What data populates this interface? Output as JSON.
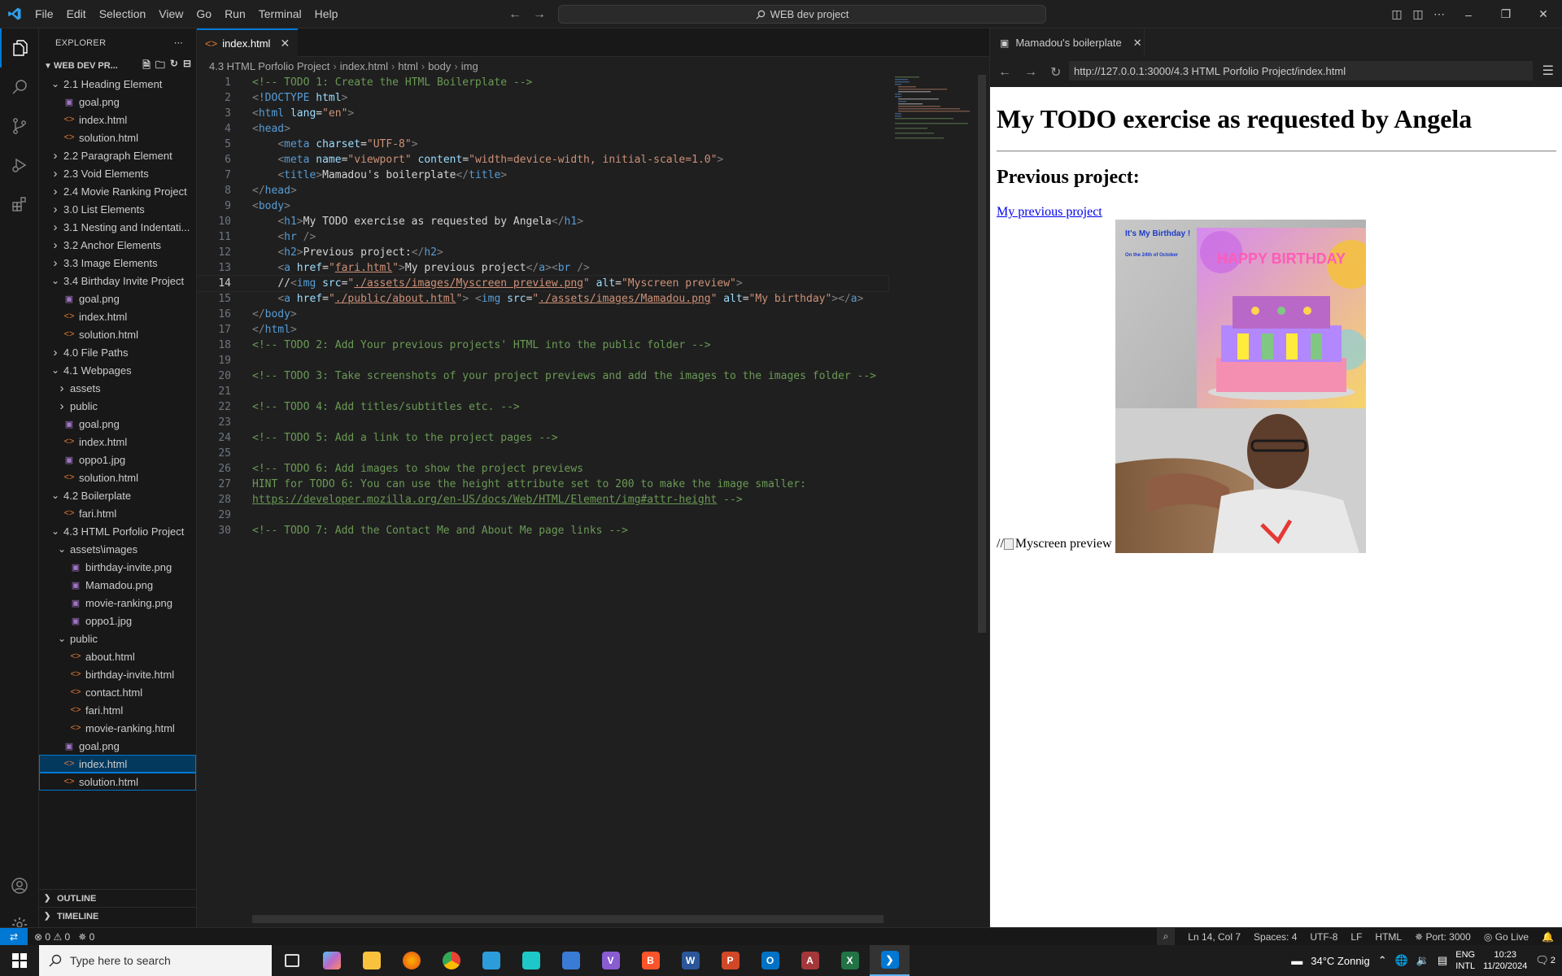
{
  "menu": [
    "File",
    "Edit",
    "Selection",
    "View",
    "Go",
    "Run",
    "Terminal",
    "Help"
  ],
  "command_center": "WEB dev project",
  "explorer": {
    "header": "EXPLORER",
    "workspace": "WEB DEV PR...",
    "items": [
      {
        "label": "2.1 Heading Element",
        "kind": "folder-open",
        "indent": 1
      },
      {
        "label": "goal.png",
        "kind": "img",
        "indent": 2
      },
      {
        "label": "index.html",
        "kind": "html",
        "indent": 2
      },
      {
        "label": "solution.html",
        "kind": "html",
        "indent": 2
      },
      {
        "label": "2.2 Paragraph Element",
        "kind": "folder",
        "indent": 1
      },
      {
        "label": "2.3 Void Elements",
        "kind": "folder",
        "indent": 1
      },
      {
        "label": "2.4 Movie Ranking Project",
        "kind": "folder",
        "indent": 1
      },
      {
        "label": "3.0 List Elements",
        "kind": "folder",
        "indent": 1
      },
      {
        "label": "3.1 Nesting and Indentati...",
        "kind": "folder",
        "indent": 1
      },
      {
        "label": "3.2 Anchor Elements",
        "kind": "folder",
        "indent": 1
      },
      {
        "label": "3.3 Image Elements",
        "kind": "folder",
        "indent": 1
      },
      {
        "label": "3.4 Birthday Invite Project",
        "kind": "folder-open",
        "indent": 1
      },
      {
        "label": "goal.png",
        "kind": "img",
        "indent": 2
      },
      {
        "label": "index.html",
        "kind": "html",
        "indent": 2
      },
      {
        "label": "solution.html",
        "kind": "html",
        "indent": 2
      },
      {
        "label": "4.0 File Paths",
        "kind": "folder",
        "indent": 1
      },
      {
        "label": "4.1 Webpages",
        "kind": "folder-open",
        "indent": 1
      },
      {
        "label": "assets",
        "kind": "folder",
        "indent": 2
      },
      {
        "label": "public",
        "kind": "folder",
        "indent": 2
      },
      {
        "label": "goal.png",
        "kind": "img",
        "indent": 2
      },
      {
        "label": "index.html",
        "kind": "html",
        "indent": 2
      },
      {
        "label": "oppo1.jpg",
        "kind": "img",
        "indent": 2
      },
      {
        "label": "solution.html",
        "kind": "html",
        "indent": 2
      },
      {
        "label": "4.2 Boilerplate",
        "kind": "folder-open",
        "indent": 1
      },
      {
        "label": "fari.html",
        "kind": "html",
        "indent": 2
      },
      {
        "label": "4.3 HTML Porfolio Project",
        "kind": "folder-open",
        "indent": 1
      },
      {
        "label": "assets\\images",
        "kind": "folder-open",
        "indent": 2
      },
      {
        "label": "birthday-invite.png",
        "kind": "img",
        "indent": 3
      },
      {
        "label": "Mamadou.png",
        "kind": "img",
        "indent": 3
      },
      {
        "label": "movie-ranking.png",
        "kind": "img",
        "indent": 3
      },
      {
        "label": "oppo1.jpg",
        "kind": "img",
        "indent": 3
      },
      {
        "label": "public",
        "kind": "folder-open",
        "indent": 2
      },
      {
        "label": "about.html",
        "kind": "html",
        "indent": 3
      },
      {
        "label": "birthday-invite.html",
        "kind": "html",
        "indent": 3
      },
      {
        "label": "contact.html",
        "kind": "html",
        "indent": 3
      },
      {
        "label": "fari.html",
        "kind": "html",
        "indent": 3
      },
      {
        "label": "movie-ranking.html",
        "kind": "html",
        "indent": 3
      },
      {
        "label": "goal.png",
        "kind": "img",
        "indent": 2
      },
      {
        "label": "index.html",
        "kind": "html",
        "indent": 2,
        "selected": true
      },
      {
        "label": "solution.html",
        "kind": "html",
        "indent": 2,
        "focused": true
      }
    ],
    "outline": "OUTLINE",
    "timeline": "TIMELINE"
  },
  "editor": {
    "tab": "index.html",
    "breadcrumbs": [
      "4.3 HTML Porfolio Project",
      "index.html",
      "html",
      "body",
      "img"
    ],
    "current_line": 14
  },
  "preview": {
    "tab": "Mamadou's boilerplate",
    "url": "http://127.0.0.1:3000/4.3 HTML Porfolio Project/index.html",
    "h1": "My TODO exercise as requested by Angela",
    "h2": "Previous project:",
    "link": "My previous project",
    "broken_prefix": "//",
    "broken_alt": "Myscreen preview",
    "photo_text1": "It's My Birthday !",
    "photo_text2": "On the 24th of October",
    "cake_text": "HAPPY BIRTHDAY"
  },
  "status": {
    "errors": "0",
    "warnings": "0",
    "ports": "0",
    "position": "Ln 14, Col 7",
    "spaces": "Spaces: 4",
    "encoding": "UTF-8",
    "eol": "LF",
    "language": "HTML",
    "port": "Port: 3000",
    "golive": "Go Live"
  },
  "taskbar": {
    "search_placeholder": "Type here to search",
    "weather": "34°C  Zonnig",
    "lang1": "ENG",
    "lang2": "INTL",
    "time": "10:23",
    "date": "11/20/2024",
    "notifications": "2"
  },
  "colors": {
    "accent": "#0078d4",
    "html_icon": "#e37933",
    "image_icon": "#a074c4"
  }
}
